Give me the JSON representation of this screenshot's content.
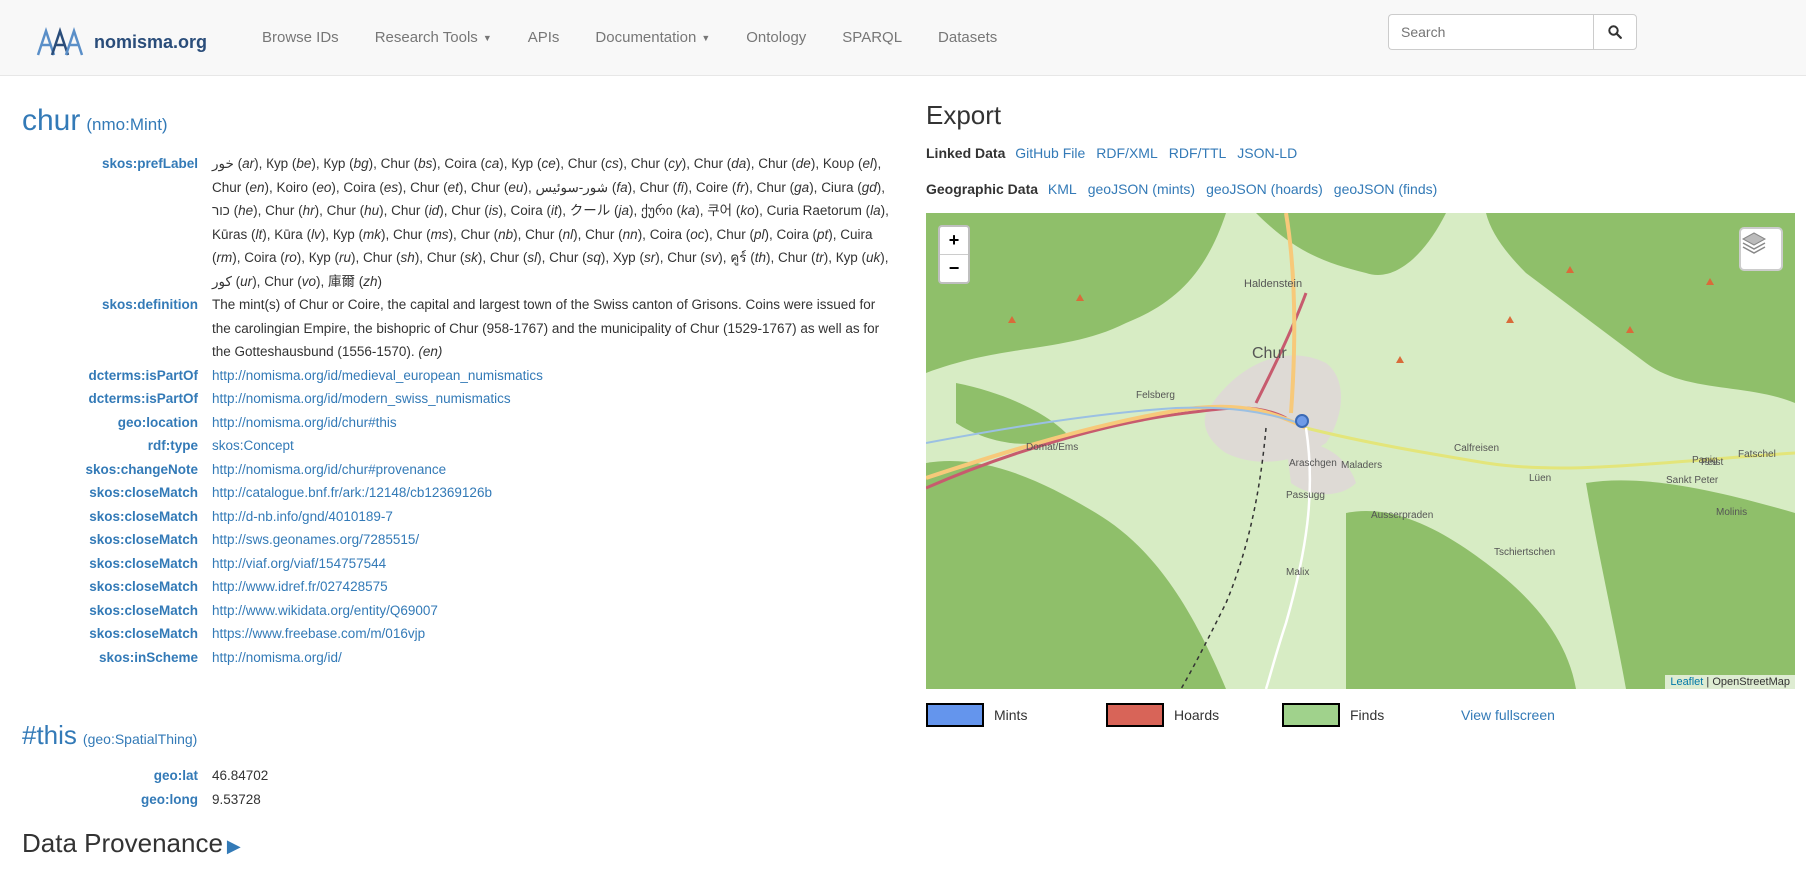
{
  "brand": {
    "name": "nomisma.org"
  },
  "nav": {
    "items": [
      {
        "label": "Browse IDs",
        "caret": false
      },
      {
        "label": "Research Tools",
        "caret": true
      },
      {
        "label": "APIs",
        "caret": false
      },
      {
        "label": "Documentation",
        "caret": true
      },
      {
        "label": "Ontology",
        "caret": false
      },
      {
        "label": "SPARQL",
        "caret": false
      },
      {
        "label": "Datasets",
        "caret": false
      }
    ],
    "search_placeholder": "Search"
  },
  "concept": {
    "title": "chur",
    "type": "(nmo:Mint)"
  },
  "pref_label": {
    "key": "skos:prefLabel",
    "labels": [
      [
        "خور",
        "ar"
      ],
      [
        "Кур",
        "be"
      ],
      [
        "Кур",
        "bg"
      ],
      [
        "Chur",
        "bs"
      ],
      [
        "Coira",
        "ca"
      ],
      [
        "Кур",
        "ce"
      ],
      [
        "Chur",
        "cs"
      ],
      [
        "Chur",
        "cy"
      ],
      [
        "Chur",
        "da"
      ],
      [
        "Chur",
        "de"
      ],
      [
        "Κουρ",
        "el"
      ],
      [
        "Chur",
        "en"
      ],
      [
        "Koiro",
        "eo"
      ],
      [
        "Coira",
        "es"
      ],
      [
        "Chur",
        "et"
      ],
      [
        "Chur",
        "eu"
      ],
      [
        "شور-سوئیس",
        "fa"
      ],
      [
        "Chur",
        "fi"
      ],
      [
        "Coire",
        "fr"
      ],
      [
        "Chur",
        "ga"
      ],
      [
        "Ciura",
        "gd"
      ],
      [
        "כור",
        "he"
      ],
      [
        "Chur",
        "hr"
      ],
      [
        "Chur",
        "hu"
      ],
      [
        "Chur",
        "id"
      ],
      [
        "Chur",
        "is"
      ],
      [
        "Coira",
        "it"
      ],
      [
        "クール",
        "ja"
      ],
      [
        "ქური",
        "ka"
      ],
      [
        "쿠어",
        "ko"
      ],
      [
        "Curia Raetorum",
        "la"
      ],
      [
        "Kūras",
        "lt"
      ],
      [
        "Kūra",
        "lv"
      ],
      [
        "Кур",
        "mk"
      ],
      [
        "Chur",
        "ms"
      ],
      [
        "Chur",
        "nb"
      ],
      [
        "Chur",
        "nl"
      ],
      [
        "Chur",
        "nn"
      ],
      [
        "Coira",
        "oc"
      ],
      [
        "Chur",
        "pl"
      ],
      [
        "Coira",
        "pt"
      ],
      [
        "Cuira",
        "rm"
      ],
      [
        "Coira",
        "ro"
      ],
      [
        "Кур",
        "ru"
      ],
      [
        "Chur",
        "sh"
      ],
      [
        "Chur",
        "sk"
      ],
      [
        "Chur",
        "sl"
      ],
      [
        "Chur",
        "sq"
      ],
      [
        "Хур",
        "sr"
      ],
      [
        "Chur",
        "sv"
      ],
      [
        "คูร์",
        "th"
      ],
      [
        "Chur",
        "tr"
      ],
      [
        "Кур",
        "uk"
      ],
      [
        "کور",
        "ur"
      ],
      [
        "Chur",
        "vo"
      ],
      [
        "庫爾",
        "zh"
      ]
    ]
  },
  "properties": [
    {
      "key": "skos:definition",
      "value": "The mint(s) of Chur or Coire, the capital and largest town of the Swiss canton of Grisons. Coins were issued for the carolingian Empire, the bishopric of Chur (958-1767) and the municipality of Chur (1529-1767) as well as for the Gotteshausbund (1556-1570).",
      "lang": "(en)",
      "is_link": false
    },
    {
      "key": "dcterms:isPartOf",
      "value": "http://nomisma.org/id/medieval_european_numismatics",
      "is_link": true
    },
    {
      "key": "dcterms:isPartOf",
      "value": "http://nomisma.org/id/modern_swiss_numismatics",
      "is_link": true
    },
    {
      "key": "geo:location",
      "value": "http://nomisma.org/id/chur#this",
      "is_link": true
    },
    {
      "key": "rdf:type",
      "value": "skos:Concept",
      "is_link": true
    },
    {
      "key": "skos:changeNote",
      "value": "http://nomisma.org/id/chur#provenance",
      "is_link": true
    },
    {
      "key": "skos:closeMatch",
      "value": "http://catalogue.bnf.fr/ark:/12148/cb12369126b",
      "is_link": true
    },
    {
      "key": "skos:closeMatch",
      "value": "http://d-nb.info/gnd/4010189-7",
      "is_link": true
    },
    {
      "key": "skos:closeMatch",
      "value": "http://sws.geonames.org/7285515/",
      "is_link": true
    },
    {
      "key": "skos:closeMatch",
      "value": "http://viaf.org/viaf/154757544",
      "is_link": true
    },
    {
      "key": "skos:closeMatch",
      "value": "http://www.idref.fr/027428575",
      "is_link": true
    },
    {
      "key": "skos:closeMatch",
      "value": "http://www.wikidata.org/entity/Q69007",
      "is_link": true
    },
    {
      "key": "skos:closeMatch",
      "value": "https://www.freebase.com/m/016vjp",
      "is_link": true
    },
    {
      "key": "skos:inScheme",
      "value": "http://nomisma.org/id/",
      "is_link": true
    }
  ],
  "this_section": {
    "title": "#this",
    "type": "(geo:SpatialThing)",
    "properties": [
      {
        "key": "geo:lat",
        "value": "46.84702"
      },
      {
        "key": "geo:long",
        "value": "9.53728"
      }
    ]
  },
  "provenance": {
    "title": "Data Provenance"
  },
  "export": {
    "title": "Export",
    "linked_data": {
      "label": "Linked Data",
      "links": [
        "GitHub File",
        "RDF/XML",
        "RDF/TTL",
        "JSON-LD"
      ]
    },
    "geographic_data": {
      "label": "Geographic Data",
      "links": [
        "KML",
        "geoJSON (mints)",
        "geoJSON (hoards)",
        "geoJSON (finds)"
      ]
    }
  },
  "map": {
    "zoom_in": "+",
    "zoom_out": "−",
    "place_labels": [
      {
        "text": "Haldenstein"
      },
      {
        "text": "Chur"
      },
      {
        "text": "Felsberg"
      },
      {
        "text": "Domat/Ems"
      },
      {
        "text": "Araschgen"
      },
      {
        "text": "Maladers"
      },
      {
        "text": "Calfreisen"
      },
      {
        "text": "Passugg"
      },
      {
        "text": "Ausserpraden"
      },
      {
        "text": "Tschiertschen"
      },
      {
        "text": "Malix"
      },
      {
        "text": "Lüen"
      },
      {
        "text": "Peist"
      },
      {
        "text": "Sankt Peter"
      },
      {
        "text": "Molinis"
      },
      {
        "text": "Pagig"
      },
      {
        "text": "Fatschel"
      }
    ],
    "attribution": {
      "leaflet": "Leaflet",
      "separator": " | ",
      "osm": "OpenStreetMap"
    },
    "colors": {
      "land": "#d7ecc4",
      "forest": "#8fbf6a",
      "town": "#dedad5",
      "road": "#f7c97a",
      "mint_marker": "#6f9be8"
    }
  },
  "legend": {
    "items": [
      {
        "label": "Mints",
        "color": "#6495ed"
      },
      {
        "label": "Hoards",
        "color": "#d86458"
      },
      {
        "label": "Finds",
        "color": "#a0d28c"
      }
    ],
    "view_fullscreen": "View fullscreen"
  }
}
